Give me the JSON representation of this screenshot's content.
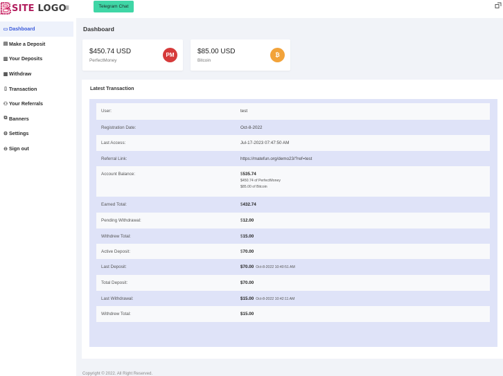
{
  "logo": {
    "text_a": "SITE",
    "text_b": " LOGO"
  },
  "topbar": {
    "telegram_label": "Telegram Chat"
  },
  "sidebar": {
    "items": [
      {
        "label": "Dashboard",
        "icon": "monitor-icon",
        "glyph": "▭"
      },
      {
        "label": "Make a Deposit",
        "icon": "database-icon",
        "glyph": "▤"
      },
      {
        "label": "Your Deposits",
        "icon": "ledger-icon",
        "glyph": "▥"
      },
      {
        "label": "Withdraw",
        "icon": "wallet-icon",
        "glyph": "▦"
      },
      {
        "label": "Transaction",
        "icon": "receipt-icon",
        "glyph": "▯"
      },
      {
        "label": "Your Referrals",
        "icon": "users-icon",
        "glyph": "⚇"
      },
      {
        "label": "Banners",
        "icon": "image-icon",
        "glyph": "⧉"
      },
      {
        "label": "Settings",
        "icon": "gear-icon",
        "glyph": "⚙"
      },
      {
        "label": "Sign out",
        "icon": "sign-out-icon",
        "glyph": "⊖"
      }
    ]
  },
  "page": {
    "title": "Dashboard"
  },
  "cards": [
    {
      "amount": "$450.74 USD",
      "label": "PerfectMoney",
      "icon": "perfectmoney-icon",
      "badge": "PM",
      "color": "#d63a3a"
    },
    {
      "amount": "$85.00 USD",
      "label": "Bitcoin",
      "icon": "bitcoin-icon",
      "badge": "₿",
      "color": "#f2a33a"
    }
  ],
  "latest": {
    "title": "Latest Transaction",
    "rows": [
      {
        "label": "User:",
        "value": "test"
      },
      {
        "label": "Registration Date:",
        "value": "Oct-8-2022"
      },
      {
        "label": "Last Access:",
        "value": "Jul-17-2023 07:47:50 AM"
      },
      {
        "label": "Referral Link:",
        "value": "https://matefun.org/demo23/?ref=test"
      },
      {
        "label": "Account Balance:",
        "prefix": "$",
        "bold": "535.74",
        "lines": [
          "$450.74 of PerfectMoney",
          "$85.00 of Bitcoin"
        ]
      },
      {
        "label": "Earned Total:",
        "prefix": "$",
        "bold": "432.74"
      },
      {
        "label": "Pending Withdrawal:",
        "prefix": "$",
        "bold": "12.00"
      },
      {
        "label": "Withdrew Total:",
        "prefix": "$",
        "bold": "15.00"
      },
      {
        "label": "Active Deposit:",
        "prefix": "$",
        "bold": "70.00"
      },
      {
        "label": "Last Deposit:",
        "bold": "$70.00",
        "timestamp": "Oct-8-2022 10:40:51 AM"
      },
      {
        "label": "Total Deposit:",
        "bold": "$70.00"
      },
      {
        "label": "Last Withdrawal:",
        "bold": "$15.00",
        "timestamp": "Oct-8-2022 10:42:11 AM"
      },
      {
        "label": "Withdrew Total:",
        "bold": "$15.00"
      }
    ]
  },
  "footer": {
    "text": "Copyright © 2022. All Right Reserved."
  }
}
